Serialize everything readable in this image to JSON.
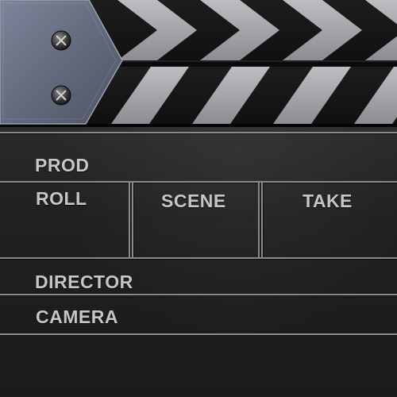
{
  "slate": {
    "prod_label": "PROD",
    "roll_label": "ROLL",
    "scene_label": "SCENE",
    "take_label": "TAKE",
    "director_label": "DIRECTOR",
    "camera_label": "CAMERA"
  },
  "icons": {
    "hinge_screws": [
      "screw-icon",
      "screw-icon"
    ]
  },
  "colors": {
    "slate_background": "#1c1c1c",
    "stripe_dark": "#161616",
    "stripe_light": "#a0a0a4",
    "hinge_plate": "#6a7183",
    "rule_lines": "#8a8a8a",
    "label_text": "#c6c6c6"
  }
}
